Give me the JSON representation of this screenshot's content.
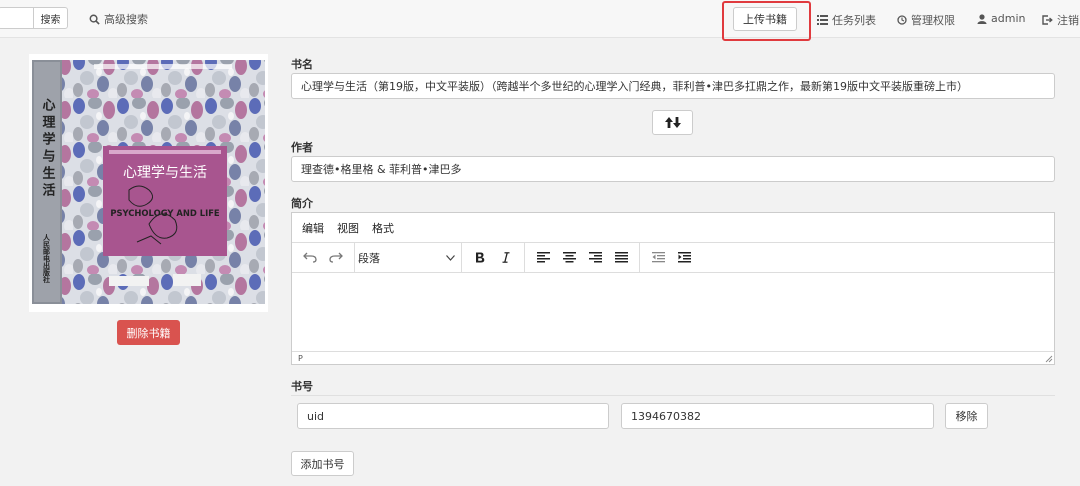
{
  "navbar": {
    "search_button": "搜索",
    "advanced_search": "高级搜索",
    "upload_button": "上传书籍",
    "task_list": "任务列表",
    "admin_settings": "管理权限",
    "user": "admin",
    "logout": "注销"
  },
  "cover": {
    "title_vertical": "心理学与生活",
    "title_band": "心理学与生活",
    "title_en": "PSYCHOLOGY AND LIFE",
    "publisher": "人民邮电出版社",
    "colors": {
      "band": "#a8558f",
      "spine": "#8a8f98"
    }
  },
  "actions": {
    "delete_button": "删除书籍"
  },
  "form": {
    "title_label": "书名",
    "title_value": "心理学与生活（第19版，中文平装版）（跨越半个多世纪的心理学入门经典，菲利普•津巴多扛鼎之作，最新第19版中文平装版重磅上市）",
    "author_label": "作者",
    "author_value": "理查德•格里格 & 菲利普•津巴多",
    "summary_label": "简介",
    "editor": {
      "menus": [
        "编辑",
        "视图",
        "格式"
      ],
      "block_format": "段落",
      "status_path": "P"
    },
    "isbn_label": "书号",
    "identifiers": [
      {
        "type": "uid",
        "value": "1394670382"
      }
    ],
    "remove_button": "移除",
    "add_button": "添加书号"
  },
  "colors": {
    "danger": "#d9534f",
    "highlight": "#e03a3e"
  }
}
